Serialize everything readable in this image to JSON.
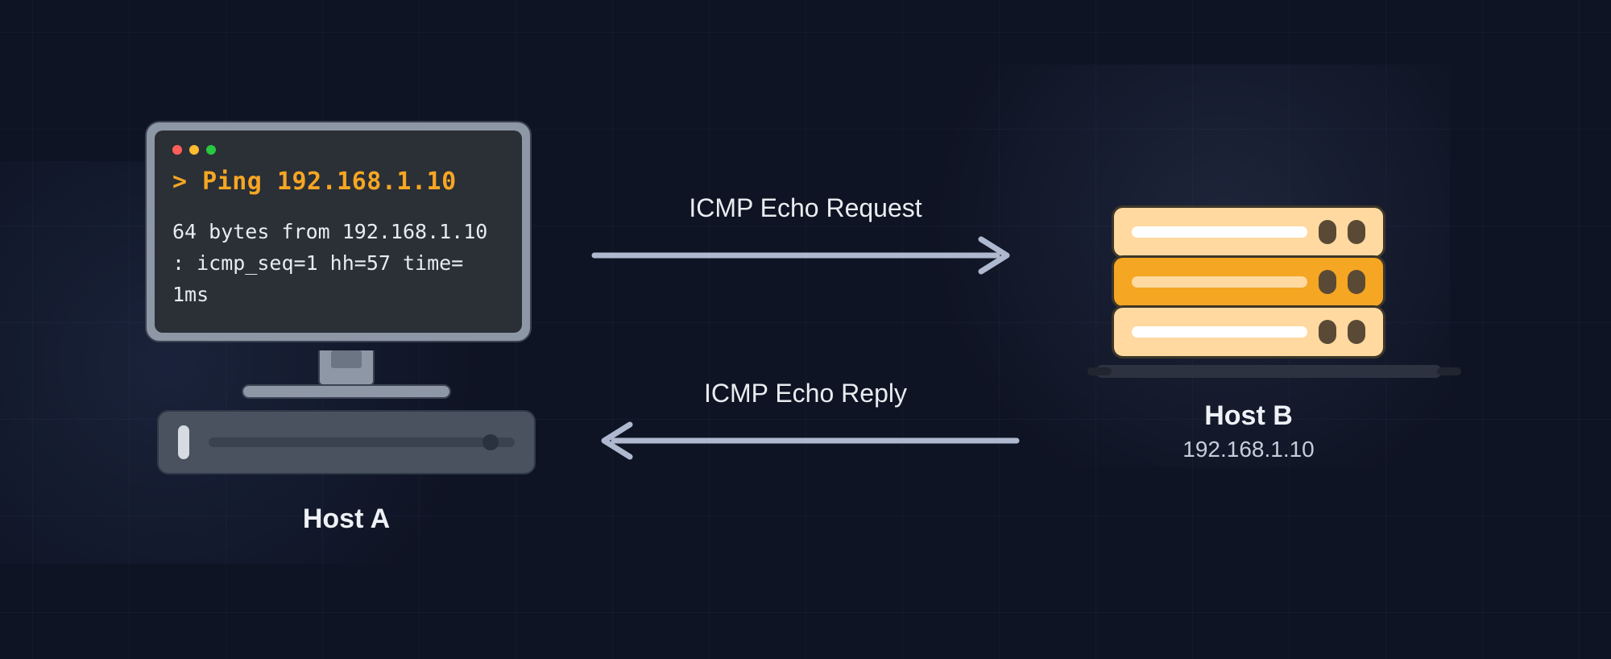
{
  "host_a": {
    "label": "Host A",
    "terminal": {
      "command": "> Ping 192.168.1.10",
      "output": "64 bytes from 192.168.1.10 : icmp_seq=1 hh=57 time= 1ms"
    }
  },
  "host_b": {
    "label": "Host B",
    "ip": "192.168.1.10"
  },
  "arrows": {
    "request": "ICMP Echo Request",
    "reply": "ICMP Echo Reply"
  },
  "colors": {
    "bg": "#0f1424",
    "accent": "#f5a623",
    "arrow": "#aeb9d0",
    "server_light": "#ffd9a0",
    "server_dark": "#f5a623"
  }
}
